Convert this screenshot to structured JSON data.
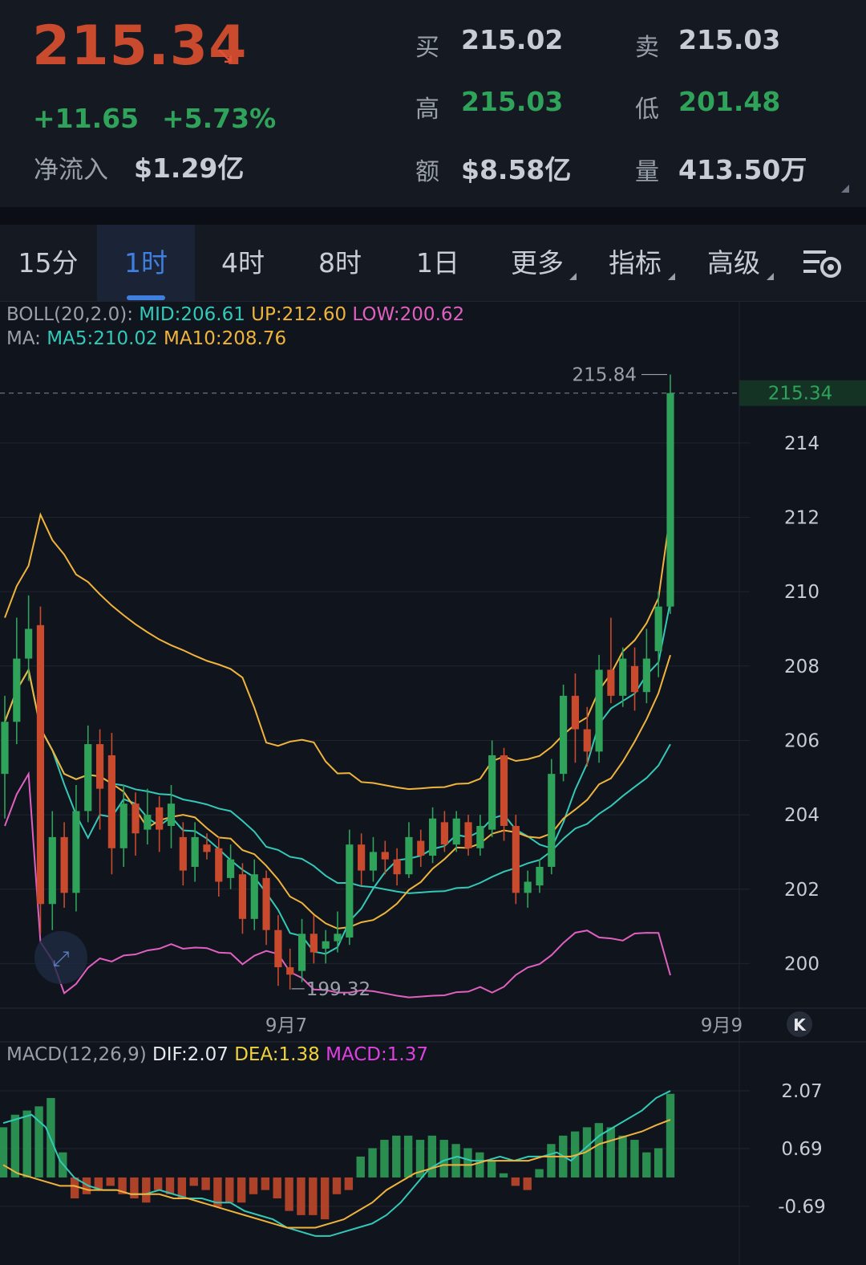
{
  "quote": {
    "price": "215.34",
    "change": "+11.65",
    "change_pct": "+5.73%",
    "net_inflow_label": "净流入",
    "net_inflow_value": "$1.29亿",
    "bid_label": "买",
    "bid": "215.02",
    "ask_label": "卖",
    "ask": "215.03",
    "high_label": "高",
    "high": "215.03",
    "low_label": "低",
    "low": "201.48",
    "amount_label": "额",
    "amount": "$8.58亿",
    "volume_label": "量",
    "volume": "413.50万"
  },
  "tabs": [
    {
      "label": "15分",
      "active": false
    },
    {
      "label": "1时",
      "active": true
    },
    {
      "label": "4时",
      "active": false
    },
    {
      "label": "8时",
      "active": false
    },
    {
      "label": "1日",
      "active": false
    },
    {
      "label": "更多",
      "active": false
    },
    {
      "label": "指标",
      "active": false
    },
    {
      "label": "高级",
      "active": false
    }
  ],
  "indicators": {
    "boll_label": "BOLL(20,2.0):",
    "boll_mid": "MID:206.61",
    "boll_up": "UP:212.60",
    "boll_low": "LOW:200.62",
    "ma_label": "MA:",
    "ma5": "MA5:210.02",
    "ma10": "MA10:208.76",
    "macd_label": "MACD(12,26,9)",
    "dif": "DIF:2.07",
    "dea": "DEA:1.38",
    "macd": "MACD:1.37"
  },
  "colors": {
    "up": "#2fa35a",
    "down": "#c94a2c",
    "mid": "#33c9b8",
    "upper": "#f0b43c",
    "lower": "#e060c0",
    "accent": "#3f7fe0"
  },
  "chart_data": {
    "type": "candlestick",
    "y_ticks": [
      "214",
      "212",
      "210",
      "208",
      "206",
      "204",
      "202",
      "200"
    ],
    "ylim": [
      198.8,
      216.5
    ],
    "current_price_tag": "215.34",
    "max_label": "215.84",
    "min_label": "199.32",
    "x_labels": [
      "9月7",
      "9月9"
    ],
    "macd_ticks": [
      "2.07",
      "0.69",
      "-0.69"
    ],
    "macd_ylim": [
      -1.9,
      2.8
    ],
    "candles": [
      {
        "o": 205.1,
        "c": 206.5,
        "h": 207.2,
        "l": 203.9
      },
      {
        "o": 206.5,
        "c": 208.2,
        "h": 209.3,
        "l": 205.9
      },
      {
        "o": 208.2,
        "c": 209.0,
        "h": 209.9,
        "l": 207.6
      },
      {
        "o": 209.1,
        "c": 201.6,
        "h": 209.6,
        "l": 200.8
      },
      {
        "o": 201.6,
        "c": 203.4,
        "h": 204.1,
        "l": 200.9
      },
      {
        "o": 203.4,
        "c": 201.9,
        "h": 203.8,
        "l": 201.5
      },
      {
        "o": 201.9,
        "c": 204.1,
        "h": 204.8,
        "l": 201.4
      },
      {
        "o": 204.1,
        "c": 205.9,
        "h": 206.4,
        "l": 203.8
      },
      {
        "o": 205.9,
        "c": 204.7,
        "h": 206.3,
        "l": 203.6
      },
      {
        "o": 205.6,
        "c": 203.1,
        "h": 206.2,
        "l": 202.4
      },
      {
        "o": 203.1,
        "c": 204.3,
        "h": 204.8,
        "l": 202.6
      },
      {
        "o": 204.3,
        "c": 203.5,
        "h": 204.6,
        "l": 202.9
      },
      {
        "o": 203.6,
        "c": 204.0,
        "h": 204.7,
        "l": 203.2
      },
      {
        "o": 204.2,
        "c": 203.6,
        "h": 204.5,
        "l": 203.0
      },
      {
        "o": 203.7,
        "c": 204.3,
        "h": 204.8,
        "l": 203.1
      },
      {
        "o": 203.4,
        "c": 202.5,
        "h": 203.8,
        "l": 202.1
      },
      {
        "o": 202.6,
        "c": 203.4,
        "h": 203.8,
        "l": 202.2
      },
      {
        "o": 203.2,
        "c": 203.0,
        "h": 203.5,
        "l": 202.8
      },
      {
        "o": 203.1,
        "c": 202.2,
        "h": 203.4,
        "l": 201.8
      },
      {
        "o": 202.3,
        "c": 202.8,
        "h": 203.2,
        "l": 202.0
      },
      {
        "o": 202.4,
        "c": 201.2,
        "h": 202.7,
        "l": 200.8
      },
      {
        "o": 201.2,
        "c": 202.4,
        "h": 202.8,
        "l": 200.9
      },
      {
        "o": 202.3,
        "c": 200.9,
        "h": 202.5,
        "l": 200.5
      },
      {
        "o": 200.9,
        "c": 199.9,
        "h": 201.3,
        "l": 199.4
      },
      {
        "o": 199.9,
        "c": 199.7,
        "h": 200.4,
        "l": 199.3
      },
      {
        "o": 199.8,
        "c": 200.8,
        "h": 201.2,
        "l": 199.5
      },
      {
        "o": 200.8,
        "c": 200.3,
        "h": 201.3,
        "l": 200.0
      },
      {
        "o": 200.4,
        "c": 200.6,
        "h": 200.9,
        "l": 200.0
      },
      {
        "o": 200.6,
        "c": 200.8,
        "h": 201.4,
        "l": 200.3
      },
      {
        "o": 200.7,
        "c": 203.2,
        "h": 203.6,
        "l": 200.5
      },
      {
        "o": 203.2,
        "c": 202.5,
        "h": 203.5,
        "l": 202.1
      },
      {
        "o": 202.5,
        "c": 203.0,
        "h": 203.4,
        "l": 202.2
      },
      {
        "o": 203.0,
        "c": 202.8,
        "h": 203.3,
        "l": 202.4
      },
      {
        "o": 202.8,
        "c": 202.4,
        "h": 203.1,
        "l": 202.1
      },
      {
        "o": 202.4,
        "c": 203.4,
        "h": 203.8,
        "l": 202.3
      },
      {
        "o": 203.3,
        "c": 202.9,
        "h": 203.6,
        "l": 202.6
      },
      {
        "o": 202.9,
        "c": 203.9,
        "h": 204.2,
        "l": 202.7
      },
      {
        "o": 203.8,
        "c": 203.2,
        "h": 204.1,
        "l": 203.0
      },
      {
        "o": 203.2,
        "c": 203.9,
        "h": 204.1,
        "l": 203.0
      },
      {
        "o": 203.8,
        "c": 203.1,
        "h": 204.0,
        "l": 202.9
      },
      {
        "o": 203.1,
        "c": 203.7,
        "h": 204.0,
        "l": 202.9
      },
      {
        "o": 203.6,
        "c": 205.6,
        "h": 206.0,
        "l": 203.4
      },
      {
        "o": 205.6,
        "c": 203.7,
        "h": 205.8,
        "l": 203.3
      },
      {
        "o": 203.7,
        "c": 201.9,
        "h": 204.0,
        "l": 201.6
      },
      {
        "o": 201.9,
        "c": 202.2,
        "h": 202.5,
        "l": 201.5
      },
      {
        "o": 202.1,
        "c": 202.6,
        "h": 202.8,
        "l": 201.9
      },
      {
        "o": 202.6,
        "c": 205.1,
        "h": 205.5,
        "l": 202.4
      },
      {
        "o": 205.1,
        "c": 207.2,
        "h": 207.5,
        "l": 204.9
      },
      {
        "o": 207.2,
        "c": 206.3,
        "h": 207.8,
        "l": 205.4
      },
      {
        "o": 206.3,
        "c": 205.7,
        "h": 206.9,
        "l": 205.3
      },
      {
        "o": 205.7,
        "c": 207.9,
        "h": 208.3,
        "l": 205.4
      },
      {
        "o": 207.9,
        "c": 207.2,
        "h": 209.3,
        "l": 207.0
      },
      {
        "o": 207.2,
        "c": 208.2,
        "h": 208.5,
        "l": 206.9
      },
      {
        "o": 208.0,
        "c": 207.3,
        "h": 208.5,
        "l": 206.8
      },
      {
        "o": 207.3,
        "c": 208.2,
        "h": 209.0,
        "l": 207.0
      },
      {
        "o": 208.4,
        "c": 209.6,
        "h": 210.0,
        "l": 207.7
      },
      {
        "o": 209.6,
        "c": 215.34,
        "h": 215.84,
        "l": 209.4
      }
    ],
    "macd_hist": [
      1.2,
      1.5,
      1.6,
      1.7,
      1.9,
      0.6,
      -0.5,
      -0.4,
      -0.3,
      -0.2,
      -0.4,
      -0.5,
      -0.6,
      -0.3,
      -0.4,
      -0.5,
      -0.2,
      -0.3,
      -0.7,
      -0.6,
      -0.6,
      -0.4,
      -0.3,
      -0.5,
      -0.8,
      -0.9,
      -0.9,
      -1.0,
      -0.4,
      -0.3,
      0.5,
      0.7,
      0.9,
      1.0,
      1.0,
      0.9,
      1.0,
      0.9,
      0.8,
      0.7,
      0.6,
      0.4,
      0.1,
      -0.2,
      -0.3,
      0.2,
      0.8,
      1.0,
      1.1,
      1.2,
      1.3,
      1.2,
      1.0,
      0.9,
      0.6,
      0.7,
      2.0
    ],
    "dif": [
      1.3,
      1.4,
      1.5,
      1.2,
      0.4,
      0.0,
      -0.2,
      -0.3,
      -0.3,
      -0.4,
      -0.4,
      -0.3,
      -0.4,
      -0.5,
      -0.5,
      -0.6,
      -0.6,
      -0.8,
      -0.9,
      -1.0,
      -1.2,
      -1.3,
      -1.4,
      -1.4,
      -1.3,
      -1.2,
      -1.1,
      -0.9,
      -0.6,
      -0.2,
      0.2,
      0.4,
      0.5,
      0.4,
      0.4,
      0.5,
      0.4,
      0.5,
      0.5,
      0.6,
      0.4,
      0.7,
      1.0,
      1.2,
      1.4,
      1.6,
      1.9,
      2.07
    ],
    "dea": [
      0.3,
      0.1,
      0.0,
      -0.1,
      -0.2,
      -0.2,
      -0.3,
      -0.3,
      -0.3,
      -0.4,
      -0.4,
      -0.4,
      -0.5,
      -0.5,
      -0.6,
      -0.7,
      -0.8,
      -0.9,
      -1.0,
      -1.1,
      -1.2,
      -1.2,
      -1.2,
      -1.1,
      -1.0,
      -0.8,
      -0.6,
      -0.3,
      -0.1,
      0.1,
      0.2,
      0.3,
      0.3,
      0.3,
      0.4,
      0.4,
      0.4,
      0.4,
      0.5,
      0.5,
      0.5,
      0.6,
      0.8,
      0.9,
      1.0,
      1.1,
      1.25,
      1.38
    ]
  }
}
